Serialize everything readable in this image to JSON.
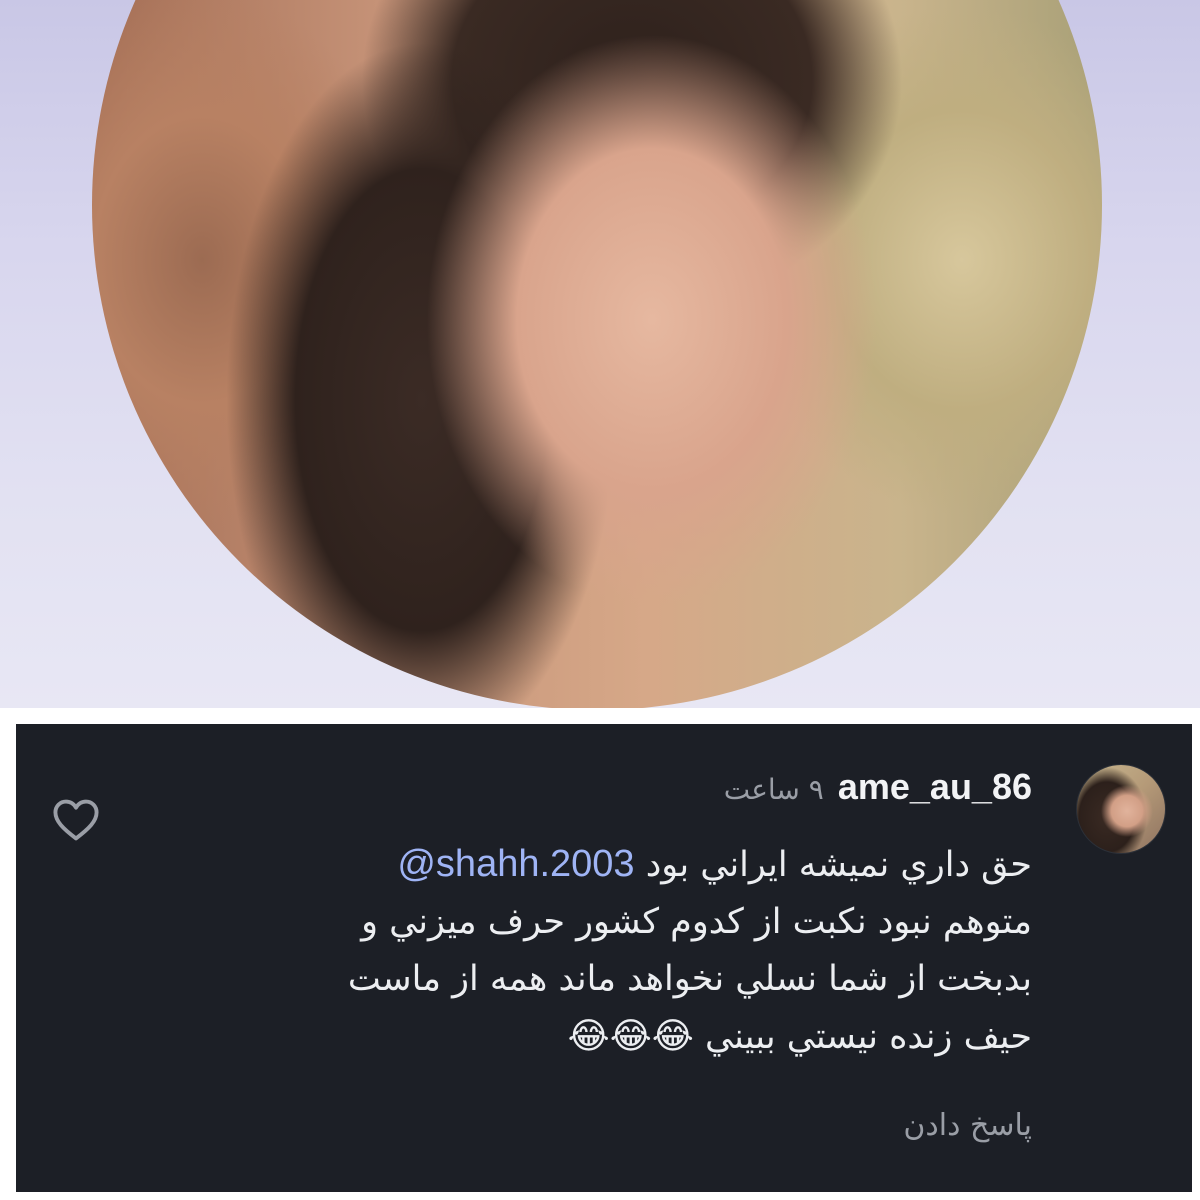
{
  "profile_photo": {
    "alt": "profile photo",
    "background_color": "#d8d6ee"
  },
  "comment": {
    "username": "ame_au_86",
    "timestamp": "۹ ساعت",
    "mention": "@shahh.2003",
    "lines": [
      "حق داري نميشه ايراني بود",
      "متوهم نبود نكبت از كدوم كشور حرف ميزني و",
      "بدبخت از شما نسلي نخواهد ماند همه از ماست",
      "حيف زنده نيستي ببيني"
    ],
    "emojis": "😂😂😂",
    "reply_label": "پاسخ دادن",
    "like_icon": "heart-outline-icon",
    "colors": {
      "card_background": "#1c1f26",
      "text": "#eceef1",
      "mention": "#9fb4f5",
      "muted": "#9a9ea6"
    }
  }
}
